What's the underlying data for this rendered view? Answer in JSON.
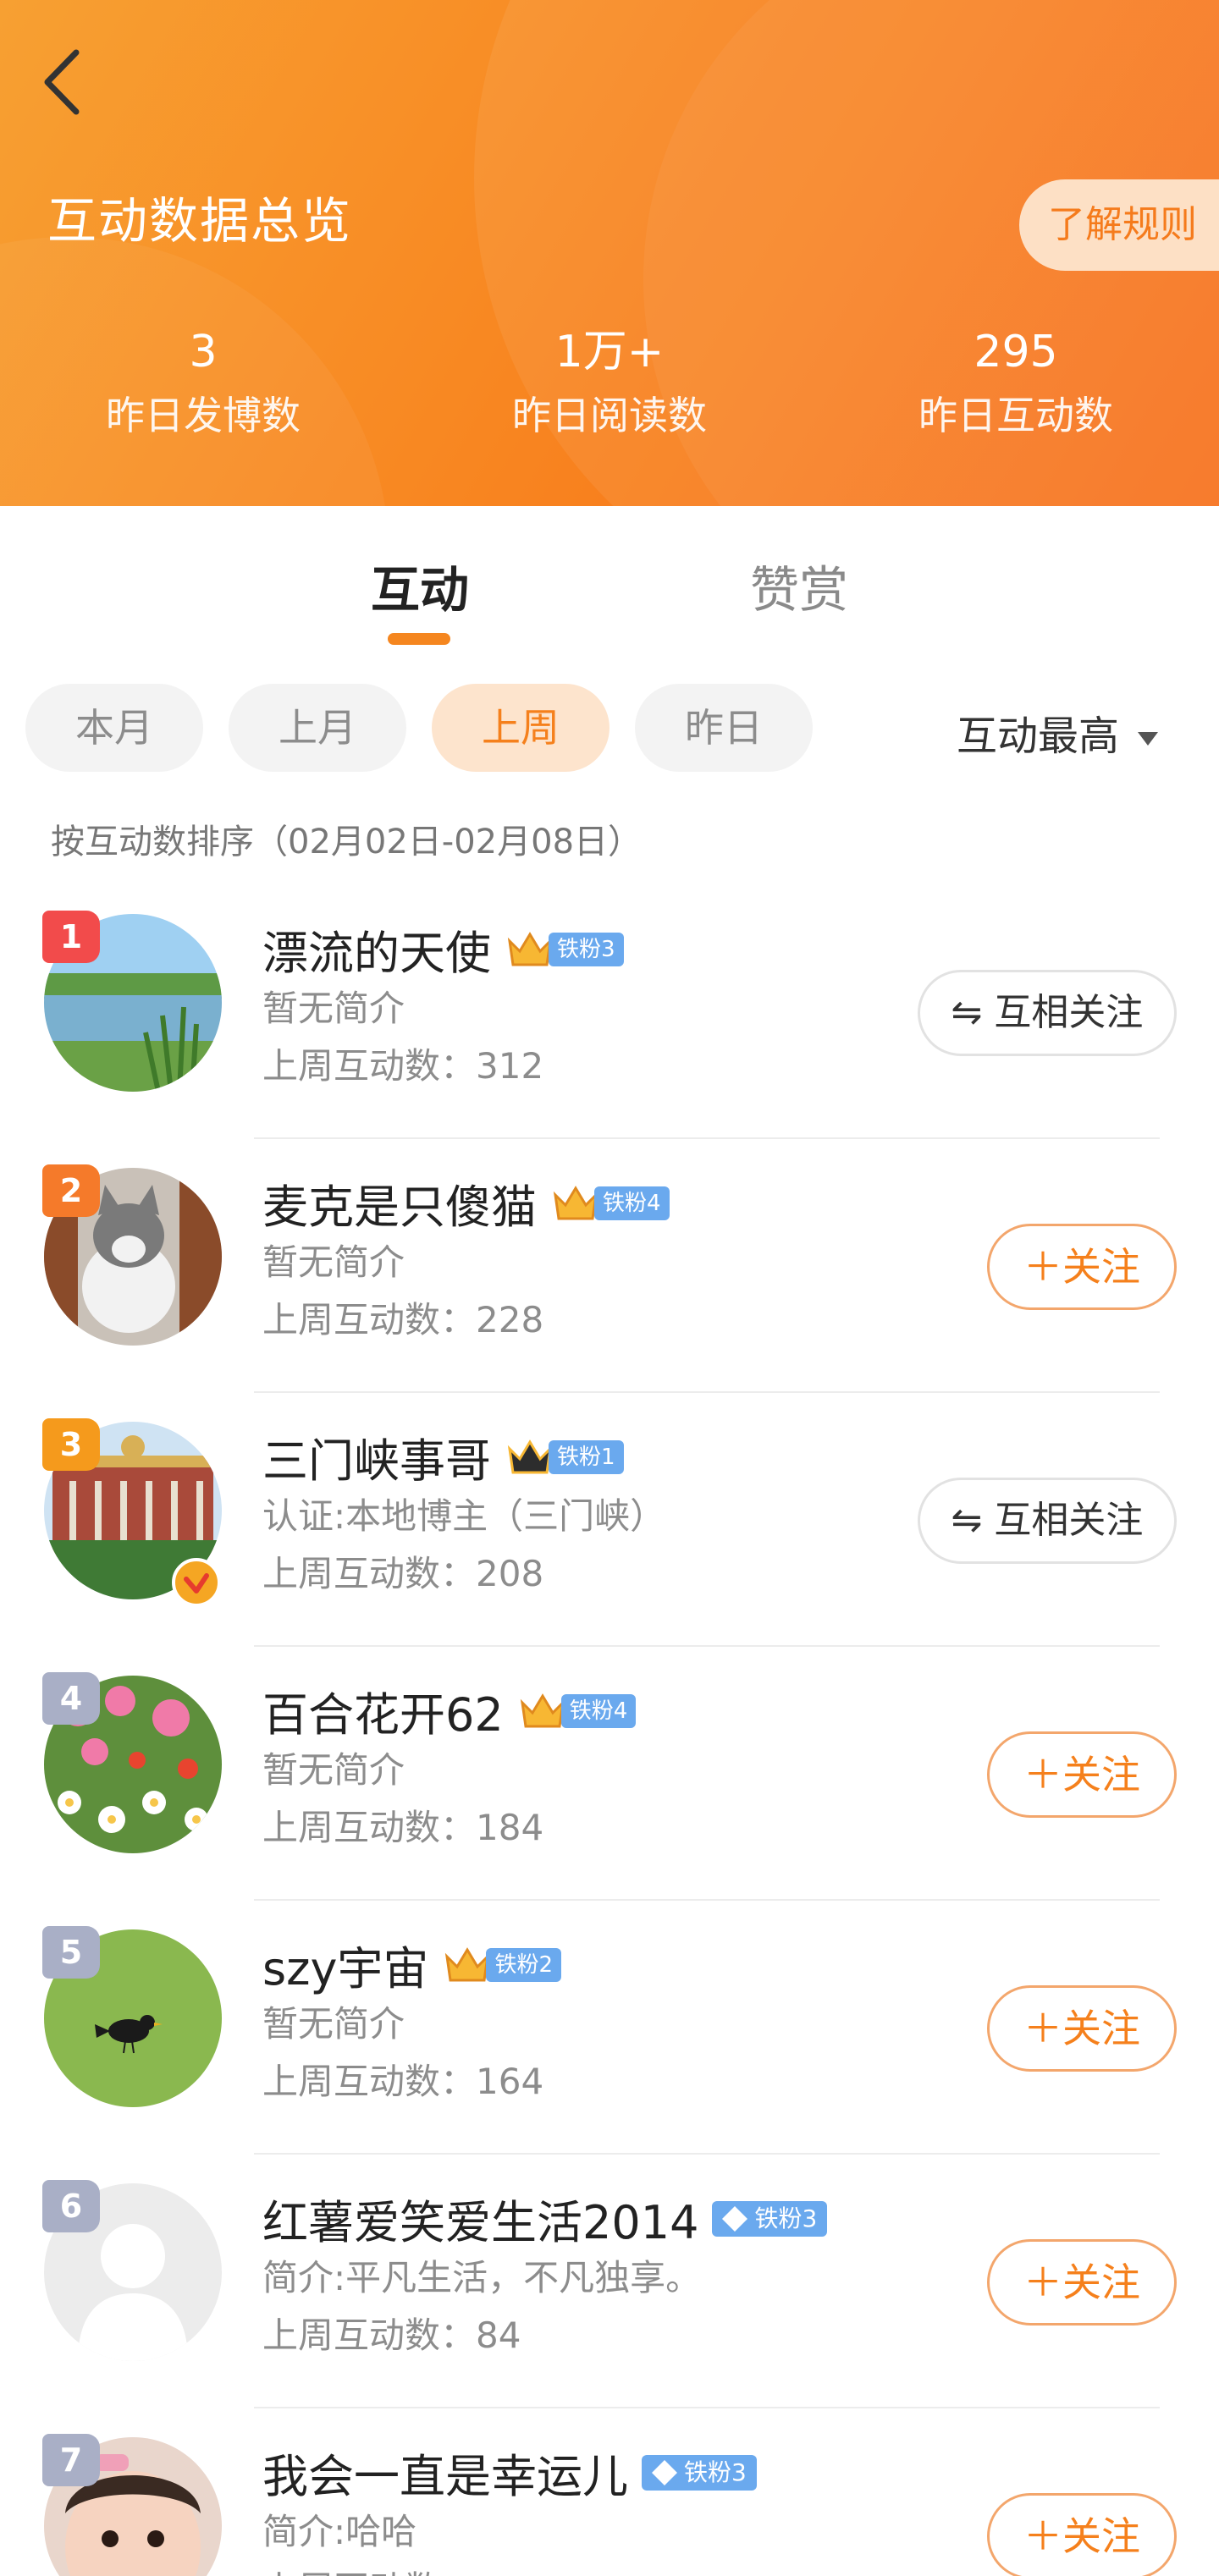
{
  "header": {
    "title": "互动数据总览",
    "rules_label": "了解规则",
    "stats": [
      {
        "value": "3",
        "label": "昨日发博数"
      },
      {
        "value": "1万+",
        "label": "昨日阅读数"
      },
      {
        "value": "295",
        "label": "昨日互动数"
      }
    ]
  },
  "tabs": [
    {
      "label": "互动",
      "active": true
    },
    {
      "label": "赞赏",
      "active": false
    }
  ],
  "filters": {
    "chips": [
      {
        "label": "本月",
        "active": false
      },
      {
        "label": "上月",
        "active": false
      },
      {
        "label": "上周",
        "active": true
      },
      {
        "label": "昨日",
        "active": false
      }
    ],
    "sort_label": "互动最高",
    "description": "按互动数排序（02月02日-02月08日）"
  },
  "list": [
    {
      "rank": "1",
      "name": "漂流的天使",
      "badge": "铁粉3",
      "badge_kind": "crown",
      "bio": "暂无简介",
      "count_text": "上周互动数：312",
      "action": "⇋ 互相关注",
      "mutual": true
    },
    {
      "rank": "2",
      "name": "麦克是只傻猫",
      "badge": "铁粉4",
      "badge_kind": "crown",
      "bio": "暂无简介",
      "count_text": "上周互动数：228",
      "action": "＋关注",
      "mutual": false
    },
    {
      "rank": "3",
      "name": "三门峡事哥",
      "badge": "铁粉1",
      "badge_kind": "crown-dark",
      "bio": "认证:本地博主（三门峡）",
      "count_text": "上周互动数：208",
      "action": "⇋ 互相关注",
      "mutual": true
    },
    {
      "rank": "4",
      "name": "百合花开62",
      "badge": "铁粉4",
      "badge_kind": "crown",
      "bio": "暂无简介",
      "count_text": "上周互动数：184",
      "action": "＋关注",
      "mutual": false
    },
    {
      "rank": "5",
      "name": "szy宇宙",
      "badge": "铁粉2",
      "badge_kind": "crown",
      "bio": "暂无简介",
      "count_text": "上周互动数：164",
      "action": "＋关注",
      "mutual": false
    },
    {
      "rank": "6",
      "name": "红薯爱笑爱生活2014",
      "badge": "铁粉3",
      "badge_kind": "diamond",
      "bio": "简介:平凡生活，不凡独享。",
      "count_text": "上周互动数：84",
      "action": "＋关注",
      "mutual": false
    },
    {
      "rank": "7",
      "name": "我会一直是幸运儿",
      "badge": "铁粉3",
      "badge_kind": "diamond",
      "bio": "简介:哈哈",
      "count_text": "上周互动数：",
      "action": "＋关注",
      "mutual": false
    }
  ]
}
